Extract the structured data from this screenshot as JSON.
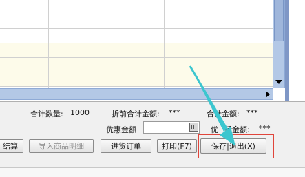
{
  "summary": {
    "qty_label": "合计数量:",
    "qty_value": "1000",
    "pre_disc_label": "折前合计金额:",
    "pre_disc_value": "***",
    "total_label": "合计金额:",
    "total_value": "***",
    "discount_label": "优惠金额",
    "discount_value": "",
    "after_disc_label_left": "优",
    "after_disc_label_right": "后金额:",
    "after_disc_value": "***"
  },
  "buttons": {
    "settle": "结算",
    "import_details": "导入商品明细",
    "purchase_order": "进货订单",
    "print": "打印(F7)",
    "save_exit": "保存|退出(X)"
  },
  "tabs": [
    "        ",
    "",
    "",
    "",
    ""
  ],
  "colors": {
    "highlight_border": "#e0453b",
    "arrow": "#3cc6cf",
    "scrollbar": "#b3c8e6",
    "row_alt": "#fdfbea"
  },
  "icons": {
    "calculator": "calculator-icon",
    "scroll_down": "scroll-down-arrow-icon",
    "scroll_right": "scroll-right-arrow-icon",
    "pointer_arrow": "annotation-arrow-icon"
  }
}
